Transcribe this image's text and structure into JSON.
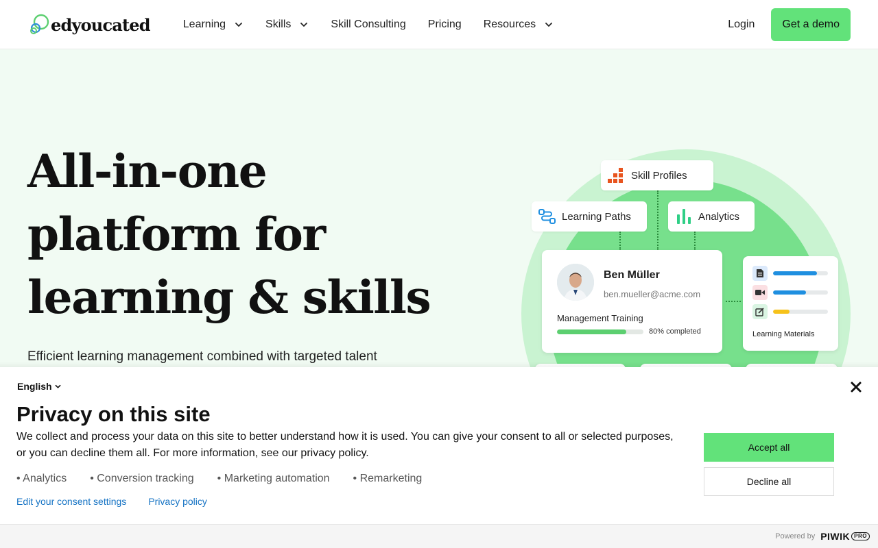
{
  "brand": {
    "name": "edyoucated",
    "accent": "#62e27a"
  },
  "nav": {
    "items": [
      {
        "label": "Learning",
        "has_dropdown": true
      },
      {
        "label": "Skills",
        "has_dropdown": true
      },
      {
        "label": "Skill Consulting",
        "has_dropdown": false
      },
      {
        "label": "Pricing",
        "has_dropdown": false
      },
      {
        "label": "Resources",
        "has_dropdown": true
      }
    ],
    "login": "Login",
    "cta": "Get a demo"
  },
  "hero": {
    "title_lines": [
      "All-in-one",
      "platform for",
      "learning & skills"
    ],
    "subtitle": "Efficient learning management combined with targeted talent"
  },
  "illustration": {
    "chips": {
      "skill_profiles": "Skill Profiles",
      "learning_paths": "Learning Paths",
      "analytics": "Analytics"
    },
    "profile": {
      "name": "Ben Müller",
      "email": "ben.mueller@acme.com",
      "training": "Management Training",
      "progress": 0.8,
      "progress_label": "80% completed"
    },
    "materials": {
      "label": "Learning Materials",
      "rows": [
        {
          "icon": "document-icon",
          "fill": 0.8,
          "color": "#1f8fe0"
        },
        {
          "icon": "video-icon",
          "fill": 0.6,
          "color": "#1f8fe0"
        },
        {
          "icon": "edit-icon",
          "fill": 0.3,
          "color": "#f6c21a"
        }
      ]
    }
  },
  "cookie_banner": {
    "language": "English",
    "title": "Privacy on this site",
    "text": "We collect and process your data on this site to better understand how it is used. You can give your consent to all or selected purposes, or you can decline them all. For more information, see our privacy policy.",
    "purposes": [
      "• Analytics",
      "• Conversion tracking",
      "• Marketing automation",
      "• Remarketing"
    ],
    "links": {
      "edit": "Edit your consent settings",
      "privacy": "Privacy policy"
    },
    "accept": "Accept all",
    "decline": "Decline all",
    "powered_by": "Powered by",
    "provider": "PIWIK",
    "provider_badge": "PRO"
  }
}
